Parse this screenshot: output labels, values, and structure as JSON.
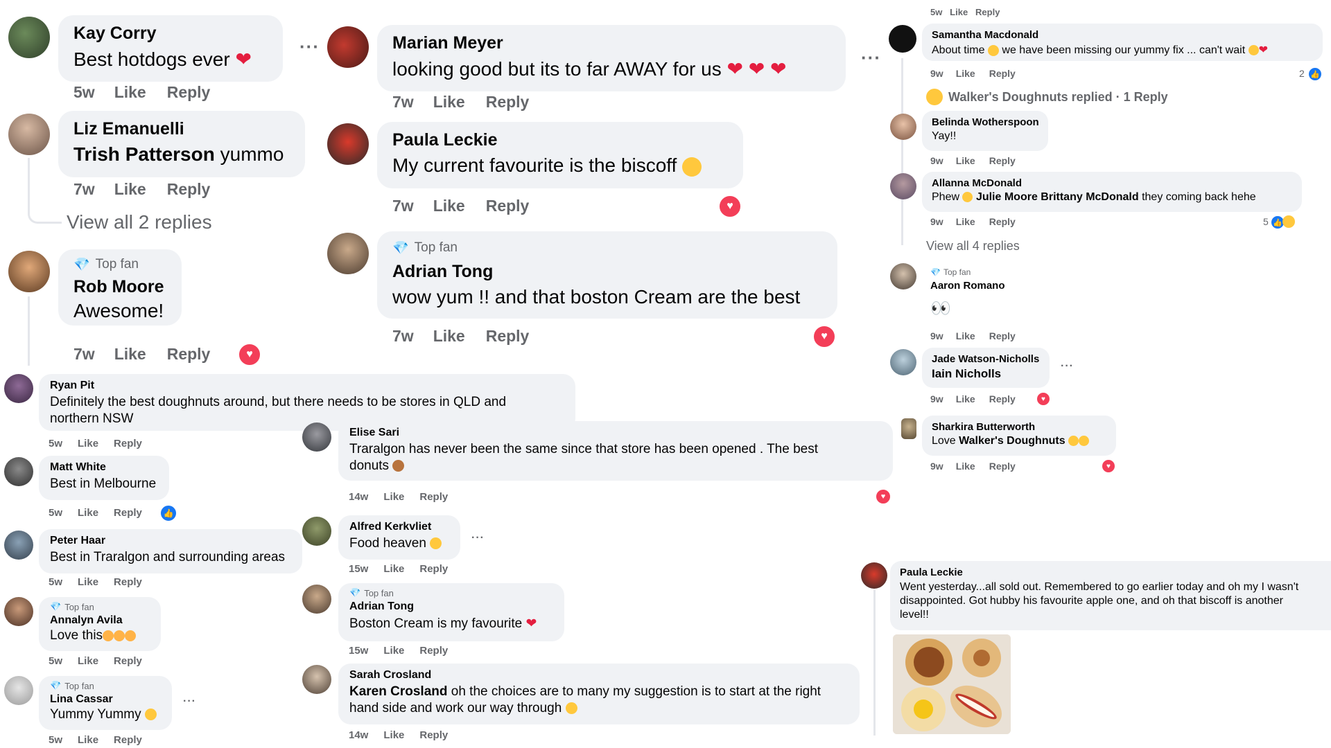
{
  "common": {
    "like": "Like",
    "reply": "Reply",
    "top_fan": "Top fan"
  },
  "col1": {
    "c1": {
      "name": "Kay Corry",
      "text": "Best hotdogs ever",
      "time": "5w"
    },
    "c2": {
      "mention": "Trish Patterson",
      "text": " yummo",
      "name": "Liz Emanuelli",
      "time": "7w"
    },
    "view_replies": "View all 2 replies",
    "c3": {
      "name": "Rob Moore",
      "text": "Awesome!",
      "time": "7w"
    }
  },
  "col2": {
    "c1": {
      "name": "Marian Meyer",
      "text": "looking good but its to far AWAY for us",
      "time": "7w"
    },
    "c2": {
      "name": "Paula Leckie",
      "text": "My current favourite is the biscoff",
      "time": "7w"
    },
    "c3": {
      "name": "Adrian Tong",
      "text": "wow yum !! and that boston Cream are the best",
      "time": "7w"
    }
  },
  "col3": {
    "top_partial": "5w   Like   Reply",
    "c1": {
      "name": "Samantha Macdonald",
      "text1": "About time",
      "text2": " we have been missing our yummy fix ... can't wait",
      "time": "9w",
      "reactions": "2"
    },
    "replied": "Walker's Doughnuts replied · 1 Reply",
    "c2": {
      "name": "Belinda Wotherspoon",
      "text": "Yay!!",
      "time": "9w"
    },
    "c3": {
      "name": "Allanna McDonald",
      "text1": "Phew",
      "mention": "Julie Moore Brittany McDonald",
      "text2": " they coming back hehe",
      "time": "9w",
      "reactions": "5"
    },
    "view_replies": "View all 4 replies",
    "c4": {
      "name": "Aaron Romano",
      "time": "9w"
    },
    "c5": {
      "name": "Jade Watson-Nicholls",
      "mention": "Iain Nicholls",
      "time": "9w"
    },
    "c6": {
      "name": "Sharkira Butterworth",
      "text": "Love ",
      "mention": "Walker's Doughnuts",
      "time": "9w"
    }
  },
  "bl": {
    "c1": {
      "name": "Ryan Pit",
      "text1": "Definitely the best doughnuts around, but there needs to be stores in QLD and",
      "text2": "northern NSW",
      "time": "5w"
    },
    "c2": {
      "name": "Matt White",
      "text": "Best in Melbourne",
      "time": "5w"
    },
    "c3": {
      "name": "Peter Haar",
      "text": "Best in Traralgon and surrounding areas",
      "time": "5w"
    },
    "c4": {
      "name": "Annalyn Avila",
      "text": "Love this",
      "time": "5w"
    },
    "c5": {
      "name": "Lina Cassar",
      "text": "Yummy Yummy",
      "time": "5w"
    }
  },
  "bm": {
    "c1": {
      "name": "Elise Sari",
      "text1": "Traralgon has never been the same since that store has been opened . The best",
      "text2": "donuts",
      "time": "14w"
    },
    "c2": {
      "name": "Alfred Kerkvliet",
      "text": "Food heaven",
      "time": "15w"
    },
    "c3": {
      "name": "Adrian Tong",
      "text": "Boston Cream is my favourite",
      "time": "15w"
    },
    "c4": {
      "name": "Sarah Crosland",
      "mention": "Karen Crosland",
      "text1": " oh the choices are to many my suggestion is to start at the right",
      "text2": "hand side and work our way through",
      "time": "14w"
    }
  },
  "br": {
    "c1": {
      "name": "Paula Leckie",
      "text1": "Went yesterday...all sold out. Remembered to go earlier today and oh my I wasn't",
      "text2": "disappointed. Got hubby his favourite apple one, and oh that biscoff is another",
      "text3": "level!!"
    }
  },
  "colors": {
    "bubble": "#f0f2f5",
    "meta": "#65676b",
    "heart": "#f33e58",
    "like": "#1877f2"
  }
}
